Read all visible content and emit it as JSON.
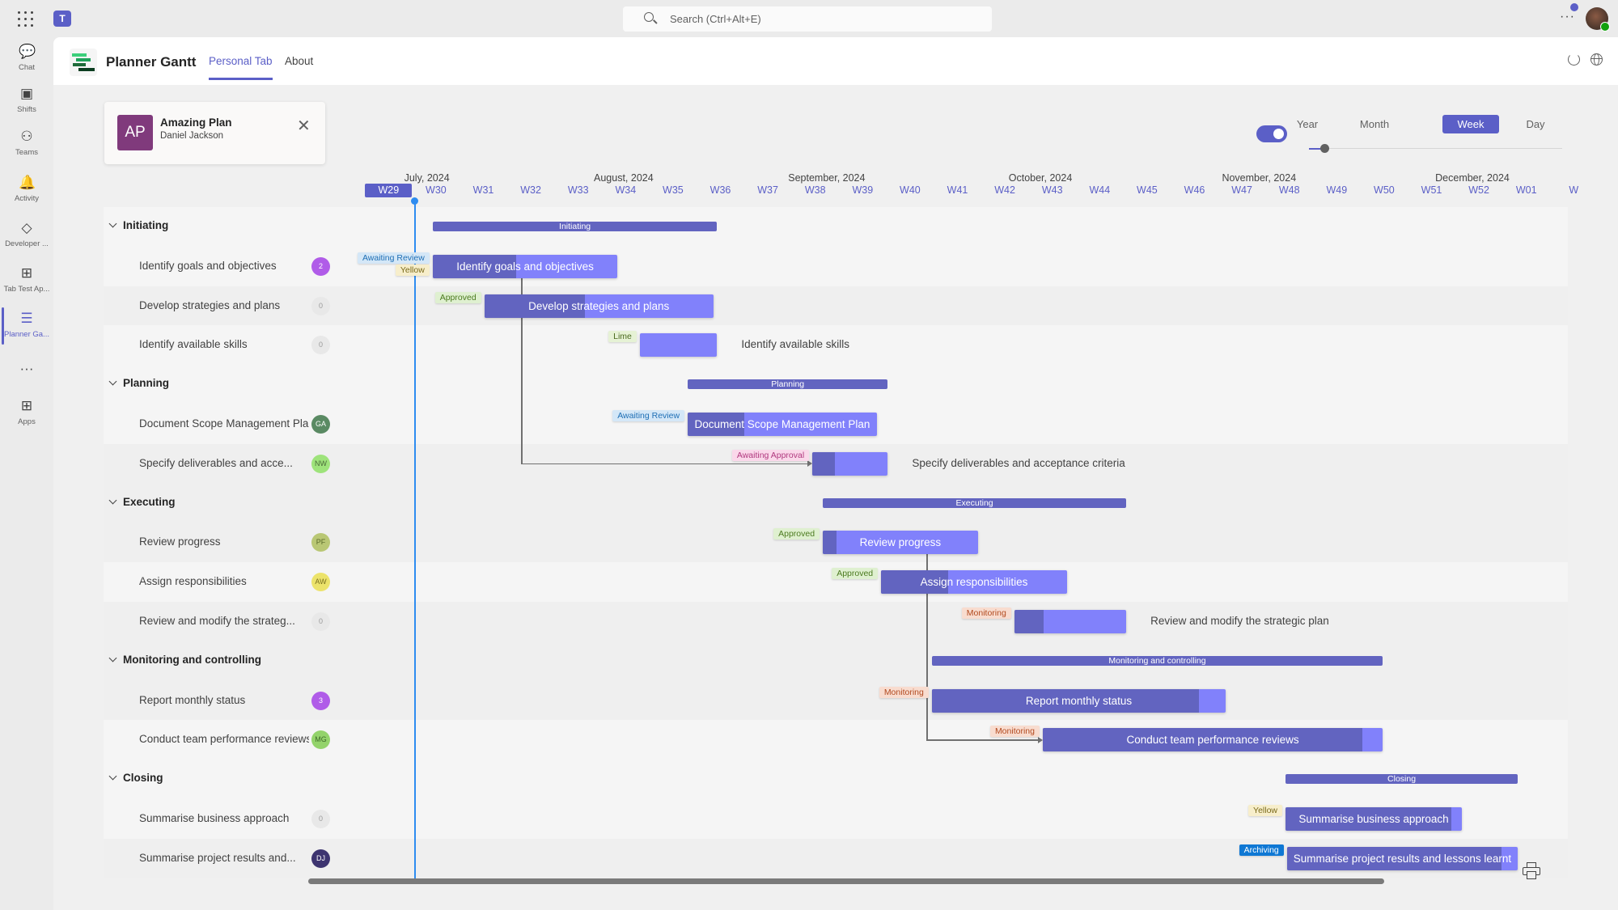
{
  "topbar": {
    "search_placeholder": "Search (Ctrl+Alt+E)",
    "more_label": "···",
    "icons": [
      "app-launcher-icon",
      "teams-logo-icon",
      "search-icon",
      "more-icon",
      "user-avatar"
    ]
  },
  "rail": {
    "items": [
      {
        "label": "Chat",
        "icon": "chat-icon",
        "glyph": "💬"
      },
      {
        "label": "Shifts",
        "icon": "shifts-icon",
        "glyph": "▣"
      },
      {
        "label": "Teams",
        "icon": "teams-icon",
        "glyph": "⚇"
      },
      {
        "label": "Activity",
        "icon": "bell-icon",
        "glyph": "🔔"
      },
      {
        "label": "Developer ...",
        "icon": "developer-portal-icon",
        "glyph": "◇"
      },
      {
        "label": "Tab Test Ap...",
        "icon": "apps-grid-icon",
        "glyph": "⊞"
      },
      {
        "label": "Planner Ga...",
        "icon": "planner-gantt-icon",
        "glyph": "☰",
        "active": true
      },
      {
        "label": "",
        "icon": "more-apps-icon",
        "glyph": "···"
      },
      {
        "label": "Apps",
        "icon": "add-app-icon",
        "glyph": "⊞"
      }
    ]
  },
  "app": {
    "title": "Planner Gantt",
    "tabs": [
      {
        "label": "Personal Tab",
        "active": true
      },
      {
        "label": "About",
        "active": false
      }
    ],
    "logo_colors": [
      "#3ccf7b",
      "#1fa15a",
      "#1f6b3a",
      "#0b3d20"
    ]
  },
  "plan": {
    "initials": "AP",
    "name": "Amazing Plan",
    "owner": "Daniel Jackson",
    "color": "#803a7c"
  },
  "view": {
    "toggle_on": true,
    "scales": [
      {
        "label": "Year"
      },
      {
        "label": "Month"
      },
      {
        "label": "Week",
        "active": true
      },
      {
        "label": "Day"
      }
    ],
    "zoom_level": 0.06
  },
  "timeline": {
    "months": [
      {
        "label": "July, 2024",
        "week": 1.0
      },
      {
        "label": "August, 2024",
        "week": 5.0
      },
      {
        "label": "September, 2024",
        "week": 9.1
      },
      {
        "label": "October, 2024",
        "week": 13.75
      },
      {
        "label": "November, 2024",
        "week": 18.25
      },
      {
        "label": "December, 2024",
        "week": 22.75
      }
    ],
    "weeks": [
      "W29",
      "W30",
      "W31",
      "W32",
      "W33",
      "W34",
      "W35",
      "W36",
      "W37",
      "W38",
      "W39",
      "W40",
      "W41",
      "W42",
      "W43",
      "W44",
      "W45",
      "W46",
      "W47",
      "W48",
      "W49",
      "W50",
      "W51",
      "W52",
      "W01",
      "W"
    ],
    "current_week": "W29",
    "today_week": 1.05
  },
  "colors": {
    "accent": "#5b5fc7",
    "bar": "#8181fb",
    "progress": "#6264c0",
    "today": "#2e8cf0"
  },
  "tag_styles": {
    "Awaiting Review": {
      "bg": "#d4e7f7",
      "fg": "#1f6fb5"
    },
    "Yellow": {
      "bg": "#f7eecb",
      "fg": "#7a6a1a"
    },
    "Approved": {
      "bg": "#dff0d0",
      "fg": "#4b7a1f"
    },
    "Lime": {
      "bg": "#e6f2d5",
      "fg": "#4b6a1f"
    },
    "Awaiting Approval": {
      "bg": "#fad8ea",
      "fg": "#b0387e"
    },
    "Monitoring": {
      "bg": "#f8dccf",
      "fg": "#b24a1f"
    },
    "Archiving": {
      "bg": "#0f78d4",
      "fg": "#ffffff"
    }
  },
  "rows": [
    {
      "type": "group",
      "name": "Initiating",
      "start": 1.43,
      "end": 7.43
    },
    {
      "type": "task",
      "name": "Identify goals and objectives",
      "badge": {
        "text": "2",
        "color": "#b05ce8"
      },
      "start": 1.43,
      "end": 5.33,
      "progress": 0.45,
      "label_inside": true,
      "tags": [
        "Awaiting Review",
        "Yellow"
      ]
    },
    {
      "type": "task",
      "name": "Develop strategies and plans",
      "badge": {
        "text": "0",
        "zero": true
      },
      "start": 2.52,
      "end": 7.35,
      "progress": 0.44,
      "label_inside": true,
      "tags": [
        "Approved"
      ]
    },
    {
      "type": "task",
      "name": "Identify available skills",
      "badge": {
        "text": "0",
        "zero": true
      },
      "start": 5.8,
      "end": 7.43,
      "progress": 0,
      "label_inside": false,
      "tags": [
        "Lime"
      ]
    },
    {
      "type": "group",
      "name": "Planning",
      "start": 6.81,
      "end": 11.03
    },
    {
      "type": "task",
      "name": "Document Scope Management Plan",
      "badge": {
        "text": "GA",
        "color": "#5a8a63"
      },
      "start": 6.81,
      "end": 10.8,
      "progress": 0.3,
      "label_inside": true,
      "tags": [
        "Awaiting Review"
      ]
    },
    {
      "type": "task",
      "name": "Specify deliverables and acce...",
      "full_name": "Specify deliverables and acceptance criteria",
      "badge": {
        "text": "NW",
        "color": "#9ee37b",
        "fg": "#4a6a3a"
      },
      "start": 9.44,
      "end": 11.03,
      "progress": 0.3,
      "label_inside": false,
      "tags": [
        "Awaiting Approval"
      ]
    },
    {
      "type": "group",
      "name": "Executing",
      "start": 9.66,
      "end": 16.06
    },
    {
      "type": "task",
      "name": "Review progress",
      "badge": {
        "text": "PF",
        "color": "#b9c774",
        "fg": "#5a6a2a"
      },
      "start": 9.66,
      "end": 12.93,
      "progress": 0.09,
      "label_inside": true,
      "tags": [
        "Approved"
      ]
    },
    {
      "type": "task",
      "name": "Assign responsibilities",
      "badge": {
        "text": "AW",
        "color": "#ece36b",
        "fg": "#7a7020"
      },
      "start": 10.89,
      "end": 14.81,
      "progress": 0.36,
      "label_inside": true,
      "tags": [
        "Approved"
      ]
    },
    {
      "type": "task",
      "name": "Review and modify the strateg...",
      "full_name": "Review and modify the strategic plan",
      "badge": {
        "text": "0",
        "zero": true
      },
      "start": 13.7,
      "end": 16.06,
      "progress": 0.26,
      "label_inside": false,
      "tags": [
        "Monitoring"
      ]
    },
    {
      "type": "group",
      "name": "Monitoring and controlling",
      "start": 11.96,
      "end": 21.47
    },
    {
      "type": "task",
      "name": "Report monthly status",
      "badge": {
        "text": "3",
        "color": "#b05ce8"
      },
      "start": 11.96,
      "end": 18.16,
      "progress": 0.91,
      "label_inside": true,
      "tags": [
        "Monitoring"
      ]
    },
    {
      "type": "task",
      "name": "Conduct team performance reviews",
      "badge": {
        "text": "MG",
        "color": "#93d36b",
        "fg": "#3f6a2a"
      },
      "start": 14.3,
      "end": 21.47,
      "progress": 0.94,
      "label_inside": true,
      "tags": [
        "Monitoring"
      ]
    },
    {
      "type": "group",
      "name": "Closing",
      "start": 19.42,
      "end": 24.32
    },
    {
      "type": "task",
      "name": "Summarise business approach",
      "badge": {
        "text": "0",
        "zero": true
      },
      "start": 19.42,
      "end": 23.14,
      "progress": 0.94,
      "label_inside": true,
      "tags": [
        "Yellow"
      ]
    },
    {
      "type": "task",
      "name": "Summarise project results and...",
      "full_name": "Summarise project results and lessons learnt",
      "badge": {
        "text": "DJ",
        "color": "#3d3470"
      },
      "start": 19.45,
      "end": 24.32,
      "progress": 0.93,
      "label_inside": true,
      "tags": [
        "Archiving"
      ]
    }
  ],
  "dependencies": [
    {
      "from": 1,
      "to": 6
    }
  ],
  "dep_trunks": [
    {
      "from_row": 1,
      "to_row": 6,
      "x_week": 3.3,
      "from_week": 5.33,
      "to_week": 9.44,
      "arrow": true
    },
    {
      "from_row": 8,
      "to_row": 13,
      "x_week": 11.85,
      "from_week": 12.93,
      "to_week": 14.3,
      "arrow": true
    }
  ],
  "footer": {
    "print_icon": "print-icon"
  }
}
